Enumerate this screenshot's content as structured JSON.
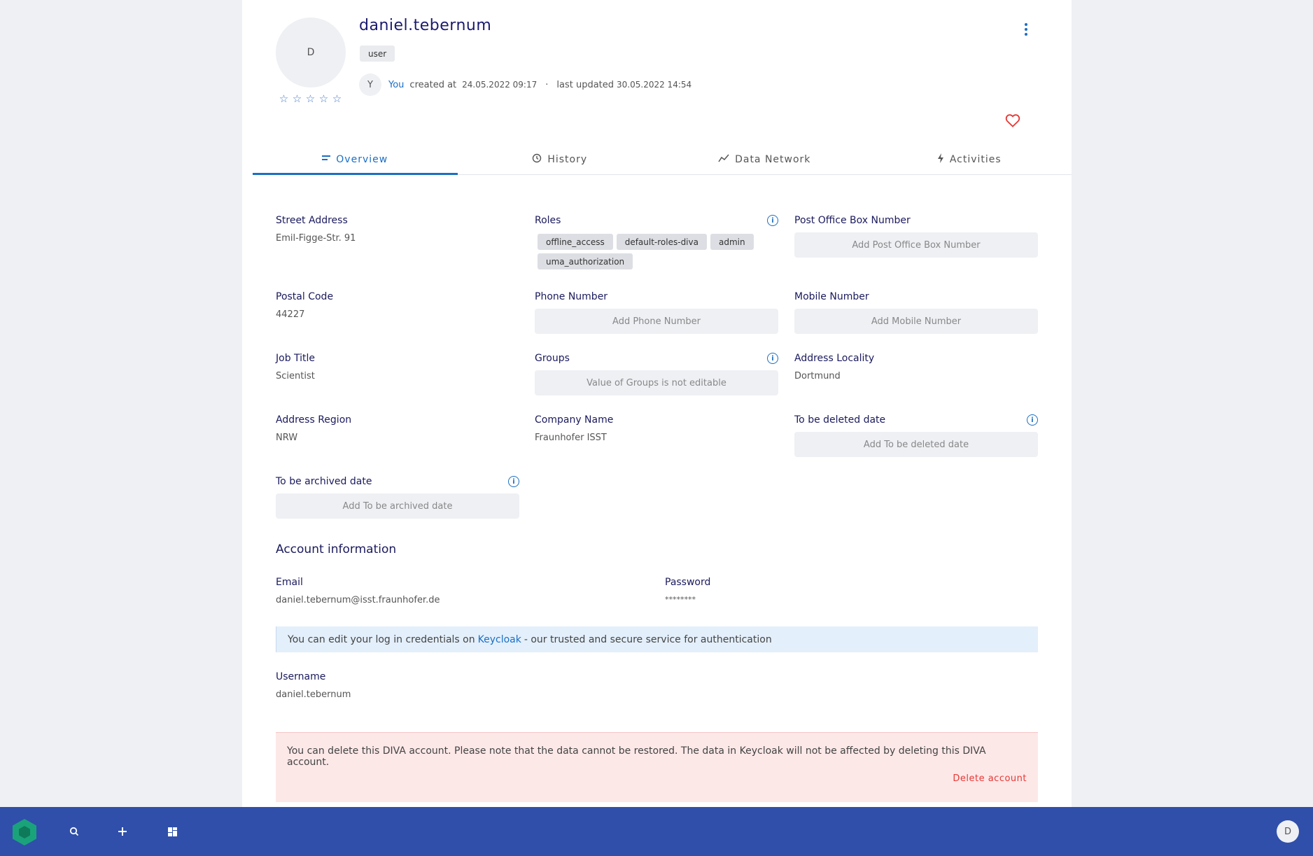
{
  "header": {
    "avatar_initial": "D",
    "username": "daniel.tebernum",
    "role_chip": "user",
    "rating": {
      "value": 0,
      "max": 5
    },
    "creator_initial": "Y",
    "creator": "You",
    "created_label": "created at",
    "created_date": "24.05.2022 09:17",
    "separator": "·",
    "updated_label": "last updated",
    "updated_date": "30.05.2022 14:54"
  },
  "tabs": [
    {
      "label": "Overview",
      "icon": "overview-icon",
      "active": true
    },
    {
      "label": "History",
      "icon": "history-icon",
      "active": false
    },
    {
      "label": "Data Network",
      "icon": "data-network-icon",
      "active": false
    },
    {
      "label": "Activities",
      "icon": "bolt-icon",
      "active": false
    }
  ],
  "fields": {
    "street_address": {
      "label": "Street Address",
      "value": "Emil-Figge-Str. 91"
    },
    "roles": {
      "label": "Roles",
      "values": [
        "offline_access",
        "default-roles-diva",
        "admin",
        "uma_authorization"
      ]
    },
    "po_box": {
      "label": "Post Office Box Number",
      "placeholder": "Add Post Office Box Number"
    },
    "postal_code": {
      "label": "Postal Code",
      "value": "44227"
    },
    "phone": {
      "label": "Phone Number",
      "placeholder": "Add Phone Number"
    },
    "mobile": {
      "label": "Mobile Number",
      "placeholder": "Add Mobile Number"
    },
    "job_title": {
      "label": "Job Title",
      "value": "Scientist"
    },
    "groups": {
      "label": "Groups",
      "placeholder": "Value of Groups is not editable"
    },
    "locality": {
      "label": "Address Locality",
      "value": "Dortmund"
    },
    "region": {
      "label": "Address Region",
      "value": "NRW"
    },
    "company": {
      "label": "Company Name",
      "value": "Fraunhofer ISST"
    },
    "delete_date": {
      "label": "To be deleted date",
      "placeholder": "Add To be deleted date"
    },
    "archive_date": {
      "label": "To be archived date",
      "placeholder": "Add To be archived date"
    }
  },
  "account": {
    "title": "Account information",
    "email_label": "Email",
    "email": "daniel.tebernum@isst.fraunhofer.de",
    "password_label": "Password",
    "password": "********",
    "notice_before": "You can edit your log in credentials on",
    "notice_link": "Keycloak",
    "notice_after": "- our trusted and secure service for authentication",
    "username_label": "Username",
    "username": "daniel.tebernum",
    "danger_text": "You can delete this DIVA account. Please note that the data cannot be restored. The data in Keycloak will not be affected by deleting this DIVA account.",
    "delete_label": "Delete account"
  },
  "bottom_bar": {
    "icons": [
      "diva-logo-icon",
      "search-icon",
      "plus-icon",
      "dashboard-icon"
    ],
    "avatar_initial": "D"
  },
  "colors": {
    "accent": "#1b6fc4",
    "bottom_bar": "#2f4faa",
    "danger": "#e53935",
    "logo": "#1aa37a"
  }
}
